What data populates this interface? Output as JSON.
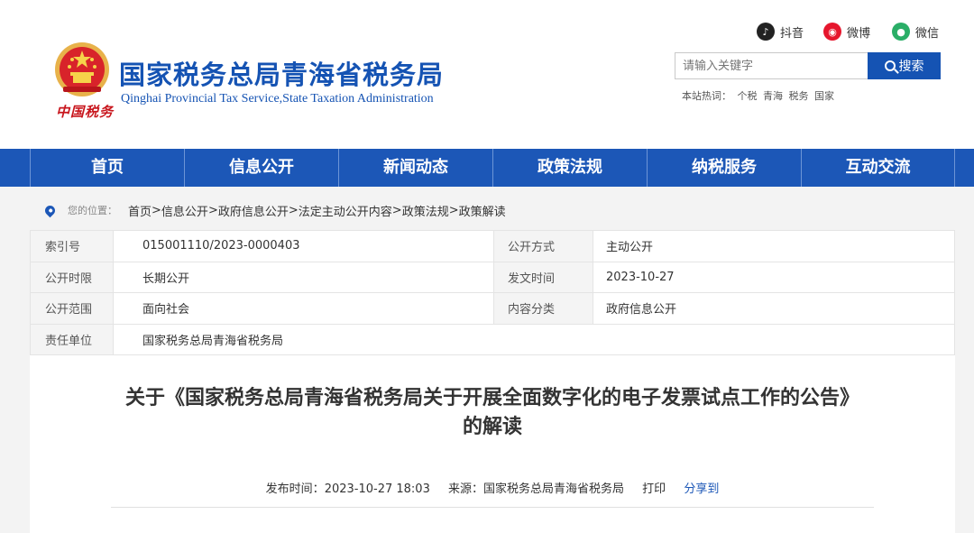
{
  "header": {
    "title": "国家税务总局青海省税务局",
    "subtitle": "Qinghai Provincial Tax Service,State Taxation Administration",
    "seal_text": "中国税务",
    "emblem_icon": "national-emblem-icon",
    "social": [
      {
        "label": "抖音",
        "icon": "douyin-icon"
      },
      {
        "label": "微博",
        "icon": "weibo-icon"
      },
      {
        "label": "微信",
        "icon": "wechat-icon"
      }
    ],
    "search": {
      "placeholder": "请输入关键字",
      "button_label": "搜索",
      "hot_label": "本站热词：",
      "hot_words": [
        "个税",
        "青海",
        "税务",
        "国家"
      ]
    }
  },
  "nav": {
    "items": [
      "首页",
      "信息公开",
      "新闻动态",
      "政策法规",
      "纳税服务",
      "互动交流"
    ]
  },
  "breadcrumb": {
    "label": "您的位置：",
    "items": [
      "首页",
      "信息公开",
      "政府信息公开",
      "法定主动公开内容",
      "政策法规",
      "政策解读"
    ],
    "separator": ">"
  },
  "info": {
    "rows": [
      {
        "k1": "索引号",
        "v1": "015001110/2023-0000403",
        "k2": "公开方式",
        "v2": "主动公开"
      },
      {
        "k1": "公开时限",
        "v1": "长期公开",
        "k2": "发文时间",
        "v2": "2023-10-27"
      },
      {
        "k1": "公开范围",
        "v1": "面向社会",
        "k2": "内容分类",
        "v2": "政府信息公开"
      },
      {
        "k1": "责任单位",
        "v1": "国家税务总局青海省税务局"
      }
    ]
  },
  "article": {
    "title": "关于《国家税务总局青海省税务局关于开展全面数字化的电子发票试点工作的公告》的解读",
    "publish_label": "发布时间：",
    "publish_time": "2023-10-27 18:03",
    "source_label": "来源：",
    "source": "国家税务总局青海省税务局",
    "print_label": "打印",
    "share_label": "分享到"
  },
  "colors": {
    "brand_blue": "#1c57b7",
    "title_blue": "#1553b3",
    "seal_red": "#c8161d"
  }
}
